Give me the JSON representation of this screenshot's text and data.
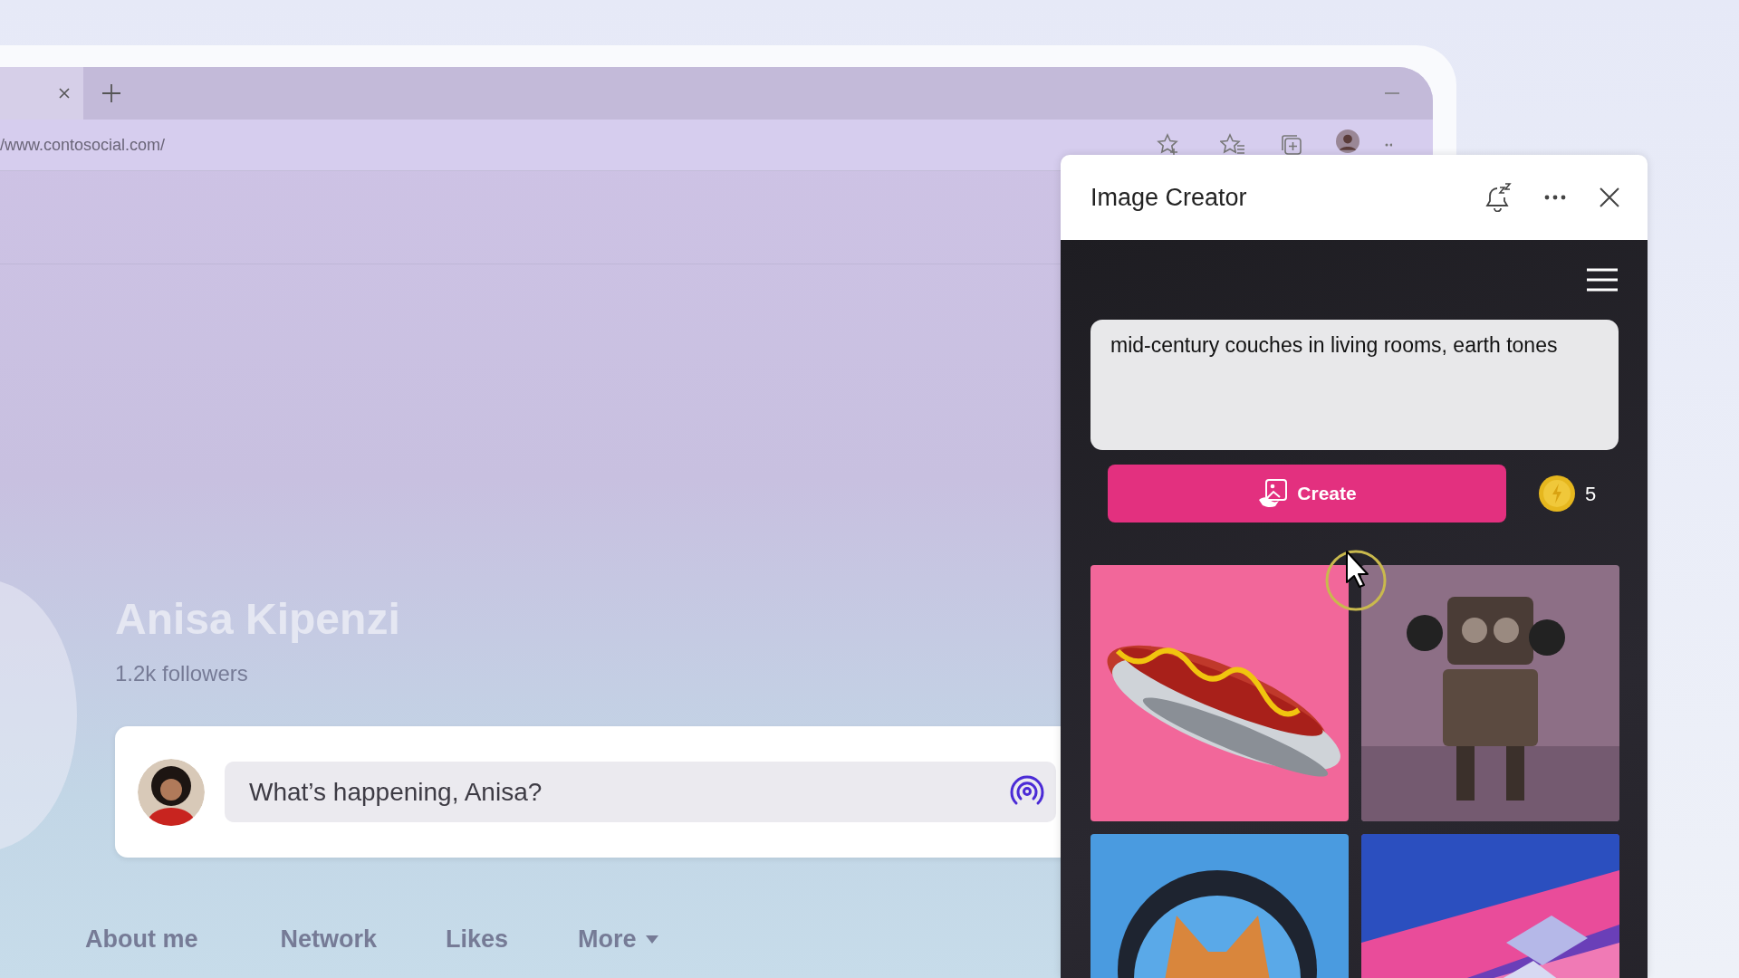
{
  "browser": {
    "address": "/www.contosocial.com/"
  },
  "profile": {
    "name": "Anisa Kipenzi",
    "followers": "1.2k followers"
  },
  "composer": {
    "placeholder": "What’s happening, Anisa?"
  },
  "profile_tabs": [
    {
      "label": "About me",
      "dropdown": false
    },
    {
      "label": "Network",
      "dropdown": false
    },
    {
      "label": "Likes",
      "dropdown": false
    },
    {
      "label": "More",
      "dropdown": true
    }
  ],
  "image_creator": {
    "title": "Image Creator",
    "prompt": "mid-century couches in living rooms, earth tones",
    "create_button": "Create",
    "boosts": "5"
  }
}
